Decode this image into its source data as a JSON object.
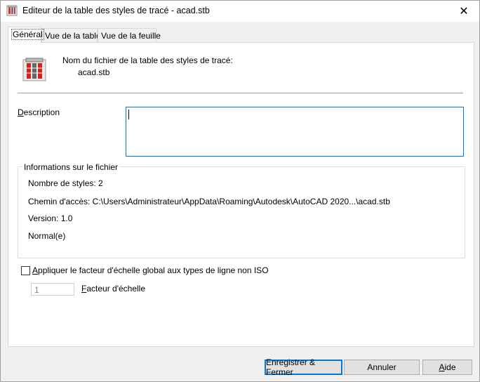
{
  "window": {
    "title": "Editeur de la table des styles de tracé - acad.stb",
    "close_glyph": "✕"
  },
  "tabs": [
    {
      "label": "Général",
      "active": true
    },
    {
      "label": "Vue de la table",
      "active": false
    },
    {
      "label": "Vue de la feuille",
      "active": false
    }
  ],
  "general": {
    "filename_label": "Nom du fichier de la table des styles de tracé:",
    "filename_value": "acad.stb",
    "description_label_first": "D",
    "description_label_rest": "escription",
    "description_value": "",
    "file_info": {
      "title": "Informations sur le fichier",
      "styles_count": "Nombre de styles: 2",
      "path": "Chemin d'accès: C:\\Users\\Administrateur\\AppData\\Roaming\\Autodesk\\AutoCAD 2020...\\acad.stb",
      "version": "Version: 1.0",
      "type": "Normal(e)"
    },
    "apply_scale_label_first": "A",
    "apply_scale_label_rest": "ppliquer le facteur d'échelle global aux types de ligne non ISO",
    "apply_scale_checked": false,
    "scale_value": "1",
    "scale_label_first": "F",
    "scale_label_rest": "acteur d'échelle"
  },
  "buttons": {
    "save_close": "Enregistrer & Fermer",
    "cancel": "Annuler",
    "help_first": "A",
    "help_rest": "ide"
  },
  "colors": {
    "accent": "#0078d7",
    "window_bg": "#f0f0f0",
    "panel_bg": "#ffffff"
  }
}
